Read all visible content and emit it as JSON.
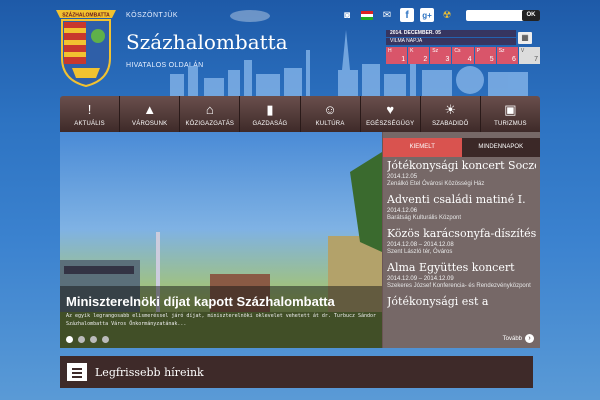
{
  "header": {
    "welcome": "KÖSZÖNTJÜK",
    "city": "Százhalombatta",
    "subtitle": "HIVATALOS OLDALÁN",
    "crest_banner": "SZÁZHALOMBATTA"
  },
  "top_icons": [
    "rss-icon",
    "flag-icon",
    "email-icon",
    "facebook-icon",
    "google-plus-icon",
    "radiation-icon"
  ],
  "search": {
    "button": "OK",
    "placeholder": ""
  },
  "calendar": {
    "date": "2014. DECEMBER. 05",
    "nameday": "VILMA NAPJA",
    "days": [
      {
        "name": "H",
        "num": "1",
        "color": "#d9556a"
      },
      {
        "name": "K",
        "num": "2",
        "color": "#d9556a"
      },
      {
        "name": "Sz",
        "num": "3",
        "color": "#d9556a"
      },
      {
        "name": "Cs",
        "num": "4",
        "color": "#d9556a"
      },
      {
        "name": "P",
        "num": "5",
        "color": "#d9556a"
      },
      {
        "name": "Sz",
        "num": "6",
        "color": "#d9556a"
      },
      {
        "name": "V",
        "num": "7",
        "color": "#dcdcdc"
      }
    ]
  },
  "nav": [
    {
      "label": "AKTUÁLIS",
      "icon": "alert-icon",
      "glyph": "!"
    },
    {
      "label": "VÁROSUNK",
      "icon": "tower-icon",
      "glyph": "▲"
    },
    {
      "label": "KÖZIGAZGATÁS",
      "icon": "building-icon",
      "glyph": "⌂"
    },
    {
      "label": "GAZDASÁG",
      "icon": "bar-chart-icon",
      "glyph": "▮"
    },
    {
      "label": "KULTÚRA",
      "icon": "mask-icon",
      "glyph": "☺"
    },
    {
      "label": "EGÉSZSÉGÜGY",
      "icon": "heart-icon",
      "glyph": "♥"
    },
    {
      "label": "SZABADIDŐ",
      "icon": "sun-icon",
      "glyph": "☀"
    },
    {
      "label": "TURIZMUS",
      "icon": "suitcase-icon",
      "glyph": "▣"
    }
  ],
  "slider": {
    "title": "Miniszterelnöki díjat kapott Százhalombatta",
    "text": "Az egyik legrangosabb elismeréssel járó díjat, miniszterelnöki oklevelet vehetett át dr. Turbucz Sándor Százhalombatta Város Önkormányzatának..."
  },
  "tabs": {
    "active": "KIEMELT",
    "other": "MINDENNAPOK"
  },
  "events": [
    {
      "title": "Jótékonysági koncert Soczó...",
      "date": "2014.12.05",
      "place": "Zenálkó Etel Óvárosi Közösségi Ház"
    },
    {
      "title": "Adventi családi matiné I.",
      "date": "2014.12.06",
      "place": "Barátság Kulturális Központ"
    },
    {
      "title": "Közös karácsonyfa-díszítés a...",
      "date": "2014.12.08 – 2014.12.08",
      "place": "Szent László tér, Óváros"
    },
    {
      "title": "Alma Együttes koncert",
      "date": "2014.12.09 – 2014.12.09",
      "place": "Szekeres József Konferencia- és Rendezvényközpont"
    },
    {
      "title": "Jótékonysági est a",
      "date": "",
      "place": ""
    }
  ],
  "more": "Tovább",
  "news": {
    "title": "Legfrissebb híreink"
  }
}
